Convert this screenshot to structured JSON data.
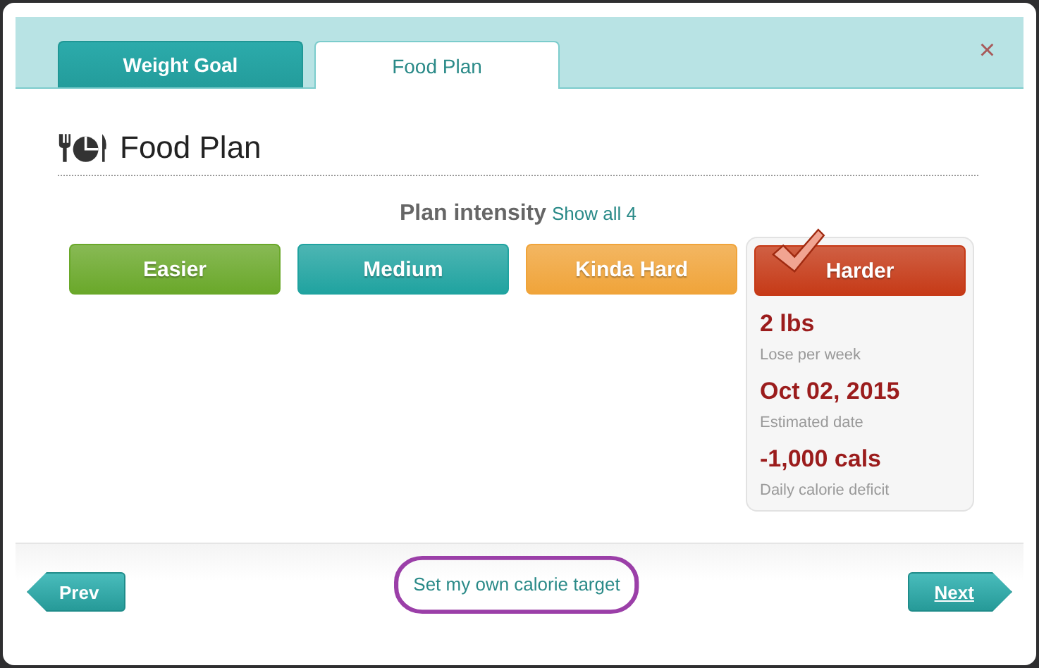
{
  "tabs": [
    {
      "label": "Weight Goal",
      "selected": false
    },
    {
      "label": "Food Plan",
      "selected": true
    }
  ],
  "close": "×",
  "heading": "Food Plan",
  "plan_intensity": {
    "label": "Plan intensity",
    "link": "Show all 4",
    "options": [
      {
        "label": "Easier",
        "color": "#6aa82a",
        "selected": false
      },
      {
        "label": "Medium",
        "color": "#20a3a0",
        "selected": false
      },
      {
        "label": "Kinda Hard",
        "color": "#f0a43a",
        "selected": false
      },
      {
        "label": "Harder",
        "color": "#c63a17",
        "selected": true
      }
    ],
    "details": [
      {
        "value": "2 lbs",
        "caption": "Lose per week"
      },
      {
        "value": "Oct 02, 2015",
        "caption": "Estimated date"
      },
      {
        "value": "-1,000 cals",
        "caption": "Daily calorie deficit"
      }
    ]
  },
  "footer": {
    "prev": "Prev",
    "link": "Set my own calorie target",
    "next": "Next"
  }
}
